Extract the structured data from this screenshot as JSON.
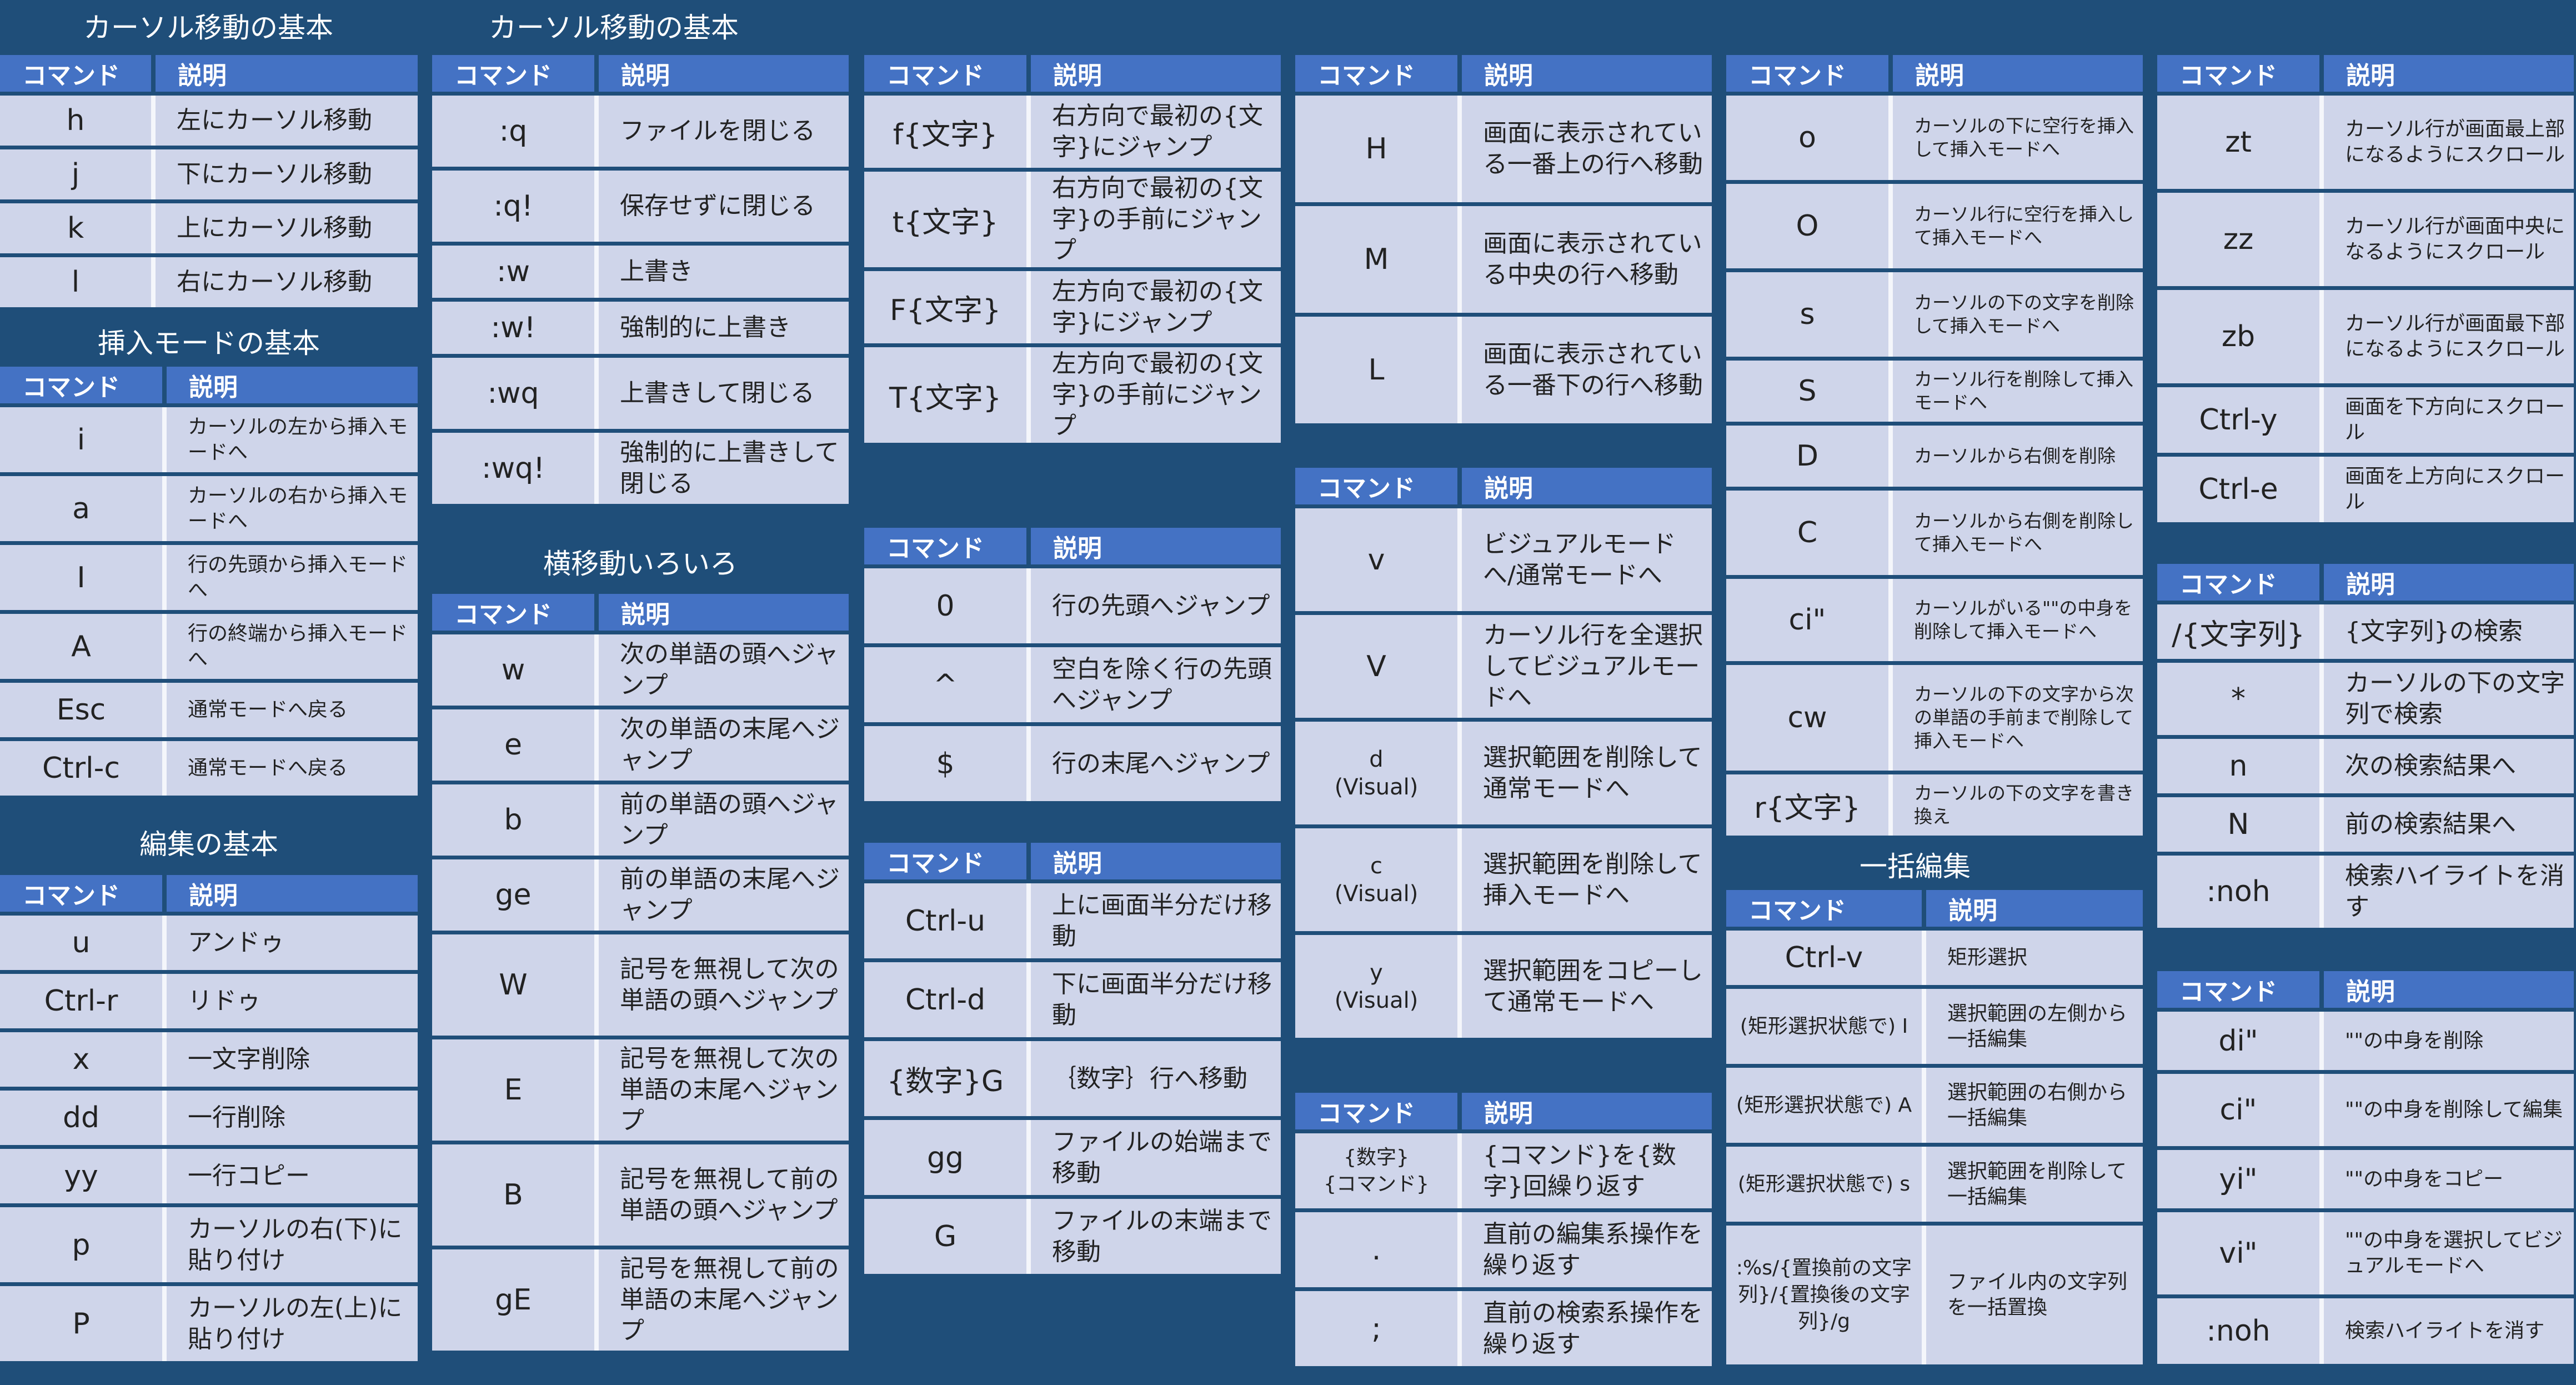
{
  "cols": {
    "c1": {
      "s1": {
        "title": "カーソル移動の基本",
        "headers": [
          "コマンド",
          "説明"
        ],
        "rows": [
          [
            "h",
            "左にカーソル移動"
          ],
          [
            "j",
            "下にカーソル移動"
          ],
          [
            "k",
            "上にカーソル移動"
          ],
          [
            "l",
            "右にカーソル移動"
          ]
        ]
      },
      "s2": {
        "title": "挿入モードの基本",
        "headers": [
          "コマンド",
          "説明"
        ],
        "rows": [
          [
            "i",
            "カーソルの左から挿入モードへ"
          ],
          [
            "a",
            "カーソルの右から挿入モードへ"
          ],
          [
            "I",
            "行の先頭から挿入モードへ"
          ],
          [
            "A",
            "行の終端から挿入モードへ"
          ],
          [
            "Esc",
            "通常モードへ戻る"
          ],
          [
            "Ctrl-c",
            "通常モードへ戻る"
          ]
        ]
      },
      "s3": {
        "title": "編集の基本",
        "headers": [
          "コマンド",
          "説明"
        ],
        "rows": [
          [
            "u",
            "アンドゥ"
          ],
          [
            "Ctrl-r",
            "リドゥ"
          ],
          [
            "x",
            "一文字削除"
          ],
          [
            "dd",
            "一行削除"
          ],
          [
            "yy",
            "一行コピー"
          ],
          [
            "p",
            "カーソルの右(下)に貼り付け"
          ],
          [
            "P",
            "カーソルの左(上)に貼り付け"
          ]
        ]
      }
    },
    "c2": {
      "s1": {
        "title": "カーソル移動の基本",
        "headers": [
          "コマンド",
          "説明"
        ],
        "rows": [
          [
            ":q",
            "ファイルを閉じる"
          ],
          [
            ":q!",
            "保存せずに閉じる"
          ],
          [
            ":w",
            "上書き"
          ],
          [
            ":w!",
            "強制的に上書き"
          ],
          [
            ":wq",
            "上書きして閉じる"
          ],
          [
            ":wq!",
            "強制的に上書きして閉じる"
          ]
        ]
      },
      "s2": {
        "title": "横移動いろいろ",
        "headers": [
          "コマンド",
          "説明"
        ],
        "rows": [
          [
            "w",
            "次の単語の頭へジャンプ"
          ],
          [
            "e",
            "次の単語の末尾へジャンプ"
          ],
          [
            "b",
            "前の単語の頭へジャンプ"
          ],
          [
            "ge",
            "前の単語の末尾へジャンプ"
          ],
          [
            "W",
            "記号を無視して次の単語の頭へジャンプ"
          ],
          [
            "E",
            "記号を無視して次の単語の末尾へジャンプ"
          ],
          [
            "B",
            "記号を無視して前の単語の頭へジャンプ"
          ],
          [
            "gE",
            "記号を無視して前の単語の末尾へジャンプ"
          ]
        ]
      }
    },
    "c3": {
      "s1": {
        "headers": [
          "コマンド",
          "説明"
        ],
        "rows": [
          [
            "f{文字}",
            "右方向で最初の{文字}にジャンプ"
          ],
          [
            "t{文字}",
            "右方向で最初の{文字}の手前にジャンプ"
          ],
          [
            "F{文字}",
            "左方向で最初の{文字}にジャンプ"
          ],
          [
            "T{文字}",
            "左方向で最初の{文字}の手前にジャンプ"
          ]
        ]
      },
      "s2": {
        "headers": [
          "コマンド",
          "説明"
        ],
        "rows": [
          [
            "0",
            "行の先頭へジャンプ"
          ],
          [
            "^",
            "空白を除く行の先頭へジャンプ"
          ],
          [
            "$",
            "行の末尾へジャンプ"
          ]
        ]
      },
      "s3": {
        "headers": [
          "コマンド",
          "説明"
        ],
        "rows": [
          [
            "Ctrl-u",
            "上に画面半分だけ移動"
          ],
          [
            "Ctrl-d",
            "下に画面半分だけ移動"
          ],
          [
            "{数字}G",
            "｛数字｝行へ移動"
          ],
          [
            "gg",
            "ファイルの始端まで移動"
          ],
          [
            "G",
            "ファイルの末端まで移動"
          ]
        ]
      }
    },
    "c4": {
      "s1": {
        "headers": [
          "コマンド",
          "説明"
        ],
        "rows": [
          [
            "H",
            "画面に表示されている一番上の行へ移動"
          ],
          [
            "M",
            "画面に表示されている中央の行へ移動"
          ],
          [
            "L",
            "画面に表示されている一番下の行へ移動"
          ]
        ]
      },
      "s2": {
        "headers": [
          "コマンド",
          "説明"
        ],
        "rows": [
          [
            "v",
            "ビジュアルモードへ/通常モードへ"
          ],
          [
            "V",
            "カーソル行を全選択してビジュアルモードへ"
          ],
          [
            "d\n(Visual)",
            "選択範囲を削除して通常モードへ"
          ],
          [
            "c\n(Visual)",
            "選択範囲を削除して挿入モードへ"
          ],
          [
            "y\n(Visual)",
            "選択範囲をコピーして通常モードへ"
          ]
        ]
      },
      "s3": {
        "headers": [
          "コマンド",
          "説明"
        ],
        "rows": [
          [
            "{数字}\n{コマンド}",
            "{コマンド}を{数字}回繰り返す"
          ],
          [
            ".",
            "直前の編集系操作を繰り返す"
          ],
          [
            ";",
            "直前の検索系操作を繰り返す"
          ]
        ]
      }
    },
    "c5": {
      "s1": {
        "headers": [
          "コマンド",
          "説明"
        ],
        "rows": [
          [
            "o",
            "カーソルの下に空行を挿入して挿入モードへ"
          ],
          [
            "O",
            "カーソル行に空行を挿入して挿入モードへ"
          ],
          [
            "s",
            "カーソルの下の文字を削除して挿入モードへ"
          ],
          [
            "S",
            "カーソル行を削除して挿入モードへ"
          ],
          [
            "D",
            "カーソルから右側を削除"
          ],
          [
            "C",
            "カーソルから右側を削除して挿入モードへ"
          ],
          [
            "ci\"",
            "カーソルがいる\"\"の中身を削除して挿入モードへ"
          ],
          [
            "cw",
            "カーソルの下の文字から次の単語の手前まで削除して挿入モードへ"
          ],
          [
            "r{文字}",
            "カーソルの下の文字を書き換え"
          ]
        ]
      },
      "s2": {
        "title": "一括編集",
        "headers": [
          "コマンド",
          "説明"
        ],
        "rows": [
          [
            "Ctrl-v",
            "矩形選択"
          ],
          [
            "(矩形選択状態で) I",
            "選択範囲の左側から一括編集"
          ],
          [
            "(矩形選択状態で) A",
            "選択範囲の右側から一括編集"
          ],
          [
            "(矩形選択状態で) s",
            "選択範囲を削除して一括編集"
          ],
          [
            ":%s/{置換前の文字列}/{置換後の文字列}/g",
            "ファイル内の文字列を一括置換"
          ]
        ]
      }
    },
    "c6": {
      "s1": {
        "headers": [
          "コマンド",
          "説明"
        ],
        "rows": [
          [
            "zt",
            "カーソル行が画面最上部になるようにスクロール"
          ],
          [
            "zz",
            "カーソル行が画面中央になるようにスクロール"
          ],
          [
            "zb",
            "カーソル行が画面最下部になるようにスクロール"
          ],
          [
            "Ctrl-y",
            "画面を下方向にスクロール"
          ],
          [
            "Ctrl-e",
            "画面を上方向にスクロール"
          ]
        ]
      },
      "s2": {
        "headers": [
          "コマンド",
          "説明"
        ],
        "rows": [
          [
            "/{文字列}",
            "{文字列}の検索"
          ],
          [
            "*",
            "カーソルの下の文字列で検索"
          ],
          [
            "n",
            "次の検索結果へ"
          ],
          [
            "N",
            "前の検索結果へ"
          ],
          [
            ":noh",
            "検索ハイライトを消す"
          ]
        ]
      },
      "s3": {
        "headers": [
          "コマンド",
          "説明"
        ],
        "rows": [
          [
            "di\"",
            "\"\"の中身を削除"
          ],
          [
            "ci\"",
            "\"\"の中身を削除して編集"
          ],
          [
            "yi\"",
            "\"\"の中身をコピー"
          ],
          [
            "vi\"",
            "\"\"の中身を選択してビジュアルモードへ"
          ],
          [
            ":noh",
            "検索ハイライトを消す"
          ]
        ]
      }
    }
  }
}
